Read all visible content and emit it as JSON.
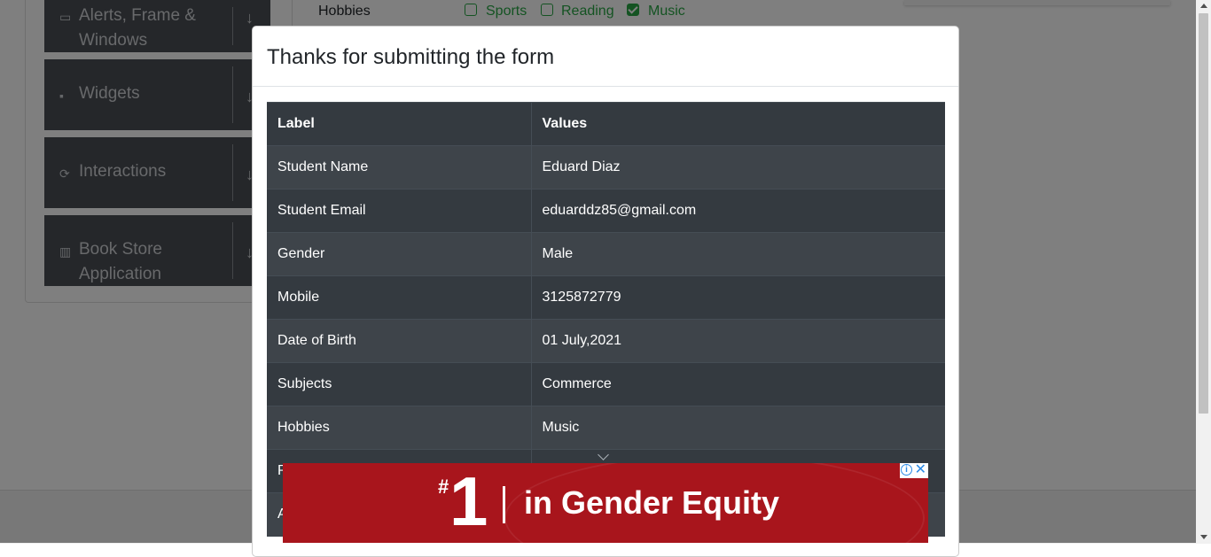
{
  "background": {
    "sidebar": [
      {
        "icon": "window-icon",
        "label_line1": "Alerts, Frame &",
        "label_line2": "Windows"
      },
      {
        "icon": "widgets-icon",
        "label_line1": "Widgets",
        "label_line2": ""
      },
      {
        "icon": "interactions-icon",
        "label_line1": "Interactions",
        "label_line2": ""
      },
      {
        "icon": "books-icon",
        "label_line1": "Book Store",
        "label_line2": "Application"
      }
    ],
    "hobbies_label": "Hobbies",
    "hobbies": [
      {
        "label": "Sports",
        "checked": false
      },
      {
        "label": "Reading",
        "checked": false
      },
      {
        "label": "Music",
        "checked": true
      }
    ]
  },
  "modal": {
    "title": "Thanks for submitting the form",
    "table": {
      "headers": [
        "Label",
        "Values"
      ],
      "rows": [
        [
          "Student Name",
          "Eduard Diaz"
        ],
        [
          "Student Email",
          "eduarddz85@gmail.com"
        ],
        [
          "Gender",
          "Male"
        ],
        [
          "Mobile",
          "3125872779"
        ],
        [
          "Date of Birth",
          "01 July,2021"
        ],
        [
          "Subjects",
          "Commerce"
        ],
        [
          "Hobbies",
          "Music"
        ],
        [
          "P",
          ""
        ],
        [
          "A",
          ""
        ]
      ]
    }
  },
  "ad": {
    "hash": "#",
    "number": "1",
    "text": "in Gender Equity",
    "background_color": "#a8151c"
  }
}
